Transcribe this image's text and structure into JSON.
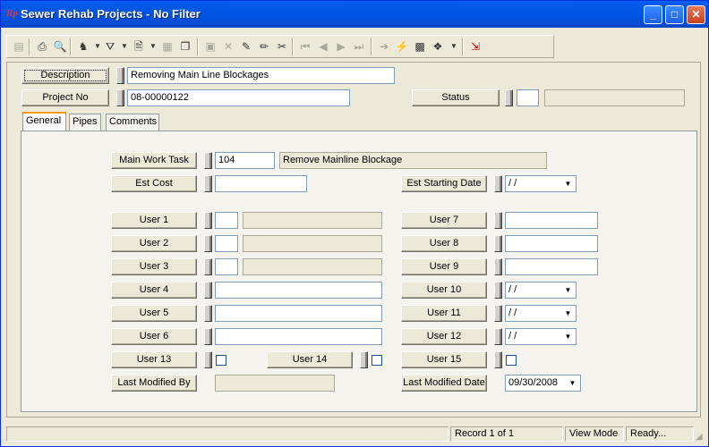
{
  "window": {
    "title": "Sewer Rehab Projects - No Filter",
    "app_icon": "Rp",
    "minimize_icon": "minimize-icon",
    "maximize_icon": "maximize-icon",
    "close_icon": "close-icon"
  },
  "header": {
    "description_label": "Description",
    "description_value": "Removing Main Line Blockages",
    "project_no_label": "Project No",
    "project_no_value": "08-00000122",
    "status_label": "Status",
    "status_code": "",
    "status_desc": ""
  },
  "tabs": [
    {
      "label": "General",
      "active": true
    },
    {
      "label": "Pipes",
      "active": false
    },
    {
      "label": "Comments",
      "active": false
    }
  ],
  "general": {
    "main_work_task_label": "Main Work Task",
    "main_work_task_code": "104",
    "main_work_task_desc": "Remove Mainline Blockage",
    "est_cost_label": "Est Cost",
    "est_cost_value": "",
    "est_start_label": "Est Starting Date",
    "est_start_value": " / /",
    "user1_label": "User 1",
    "user2_label": "User 2",
    "user3_label": "User 3",
    "user4_label": "User 4",
    "user5_label": "User 5",
    "user6_label": "User 6",
    "user7_label": "User 7",
    "user8_label": "User 8",
    "user9_label": "User 9",
    "user10_label": "User 10",
    "user10_value": " / /",
    "user11_label": "User 11",
    "user11_value": " / /",
    "user12_label": "User 12",
    "user12_value": " / /",
    "user13_label": "User 13",
    "user14_label": "User 14",
    "user15_label": "User 15",
    "last_modified_by_label": "Last Modified By",
    "last_modified_by_value": "",
    "last_modified_date_label": "Last Modified Date",
    "last_modified_date_value": "09/30/2008"
  },
  "statusbar": {
    "record": "Record 1 of 1",
    "mode": "View Mode",
    "state": "Ready..."
  }
}
